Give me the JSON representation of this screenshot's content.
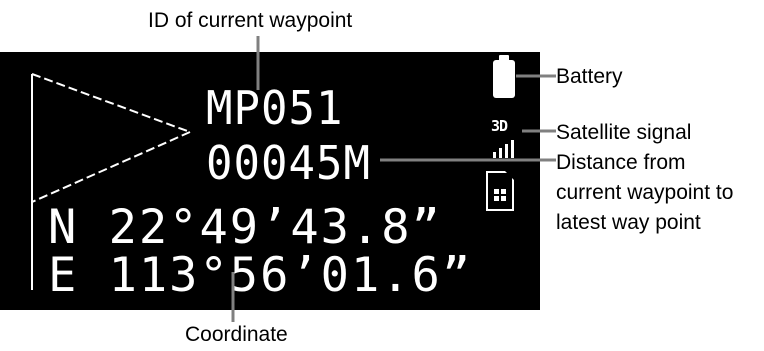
{
  "callouts": {
    "waypoint_id": "ID of current waypoint",
    "battery": "Battery",
    "satellite": "Satellite signal",
    "distance_line1": "Distance from",
    "distance_line2": "current waypoint to",
    "distance_line3": "latest way point",
    "coordinate": "Coordinate"
  },
  "display": {
    "waypoint_id": "MP051",
    "distance": "00045M",
    "satellite_mode": "3D",
    "latitude": "N 22°49’43.8”",
    "longitude": "E 113°56’01.6”"
  },
  "icons": [
    "flag-icon",
    "battery-icon",
    "satellite-signal-icon",
    "memory-card-icon"
  ],
  "colors": {
    "screen": "#000000",
    "lcd_text": "#ffffff",
    "label_text": "#000000",
    "leader": "#808080"
  }
}
